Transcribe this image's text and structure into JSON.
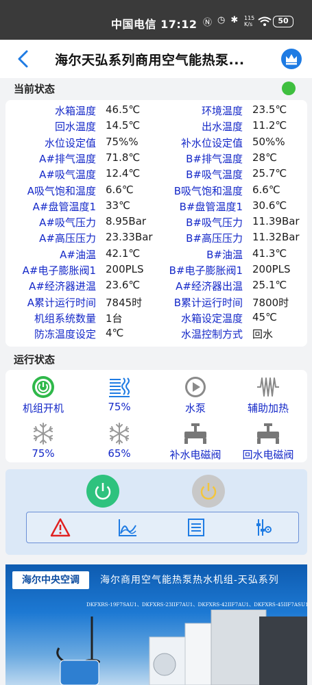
{
  "status_bar": {
    "carrier_time": "中国电信 17:12",
    "net_speed_value": "115",
    "net_speed_unit": "K/s",
    "battery": "50"
  },
  "nav": {
    "title": "海尔天弘系列商用空气能热泵..."
  },
  "current_status": {
    "label": "当前状态",
    "indicator_color": "#3fbf3f",
    "params": [
      {
        "l1": "水箱温度",
        "v1": "46.5℃",
        "l2": "环境温度",
        "v2": "23.5℃"
      },
      {
        "l1": "回水温度",
        "v1": "14.5℃",
        "l2": "出水温度",
        "v2": "11.2℃"
      },
      {
        "l1": "水位设定值",
        "v1": "75%%",
        "l2": "补水位设定值",
        "v2": "50%%"
      },
      {
        "l1": "A#排气温度",
        "v1": "71.8℃",
        "l2": "B#排气温度",
        "v2": "28℃"
      },
      {
        "l1": "A#吸气温度",
        "v1": "12.4℃",
        "l2": "B#吸气温度",
        "v2": "25.7℃"
      },
      {
        "l1": "A吸气饱和温度",
        "v1": "6.6℃",
        "l2": "B吸气饱和温度",
        "v2": "6.6℃"
      },
      {
        "l1": "A#盘管温度1",
        "v1": "33℃",
        "l2": "B#盘管温度1",
        "v2": "30.6℃"
      },
      {
        "l1": "A#吸气压力",
        "v1": "8.95Bar",
        "l2": "B#吸气压力",
        "v2": "11.39Bar"
      },
      {
        "l1": "A#高压压力",
        "v1": "23.33Bar",
        "l2": "B#高压压力",
        "v2": "11.32Bar"
      },
      {
        "l1": "A#油温",
        "v1": "42.1℃",
        "l2": "B#油温",
        "v2": "41.3℃"
      },
      {
        "l1": "A#电子膨胀阀1",
        "v1": "200PLS",
        "l2": "B#电子膨胀阀1",
        "v2": "200PLS"
      },
      {
        "l1": "A#经济器进温",
        "v1": "23.6℃",
        "l2": "A#经济器出温",
        "v2": "25.1℃"
      },
      {
        "l1": "A累计运行时间",
        "v1": "7845时",
        "l2": "B累计运行时间",
        "v2": "7800时"
      },
      {
        "l1": "机组系统数量",
        "v1": "1台",
        "l2": "水箱设定温度",
        "v2": "45℃"
      },
      {
        "l1": "防冻温度设定",
        "v1": "4℃",
        "l2": "水温控制方式",
        "v2": "回水"
      }
    ]
  },
  "run_status": {
    "label": "运行状态",
    "items": [
      {
        "label": "机组开机",
        "icon": "power-icon"
      },
      {
        "label": "75%",
        "icon": "fan-coil-icon"
      },
      {
        "label": "水泵",
        "icon": "pump-play-icon"
      },
      {
        "label": "辅助加热",
        "icon": "heater-icon"
      },
      {
        "label": "75%",
        "icon": "snowflake-icon"
      },
      {
        "label": "65%",
        "icon": "snowflake-icon"
      },
      {
        "label": "补水电磁阀",
        "icon": "valve-icon"
      },
      {
        "label": "回水电磁阀",
        "icon": "valve-icon"
      }
    ]
  },
  "controls": {
    "power_on_color": "#2ec27e",
    "power_off_color": "#c8c8c8",
    "tools": [
      "alarm-icon",
      "chart-icon",
      "list-icon",
      "settings-sliders-icon"
    ]
  },
  "banner": {
    "logo": "海尔中央空调",
    "title": "海尔商用空气能热泵热水机组-天弘系列",
    "models": "DKFXRS-19F7SAU1、DKFXRS-23IIF7AU1、DKFXRS-42IIF7AU1、DKFXRS-45IIF7ASU1"
  }
}
